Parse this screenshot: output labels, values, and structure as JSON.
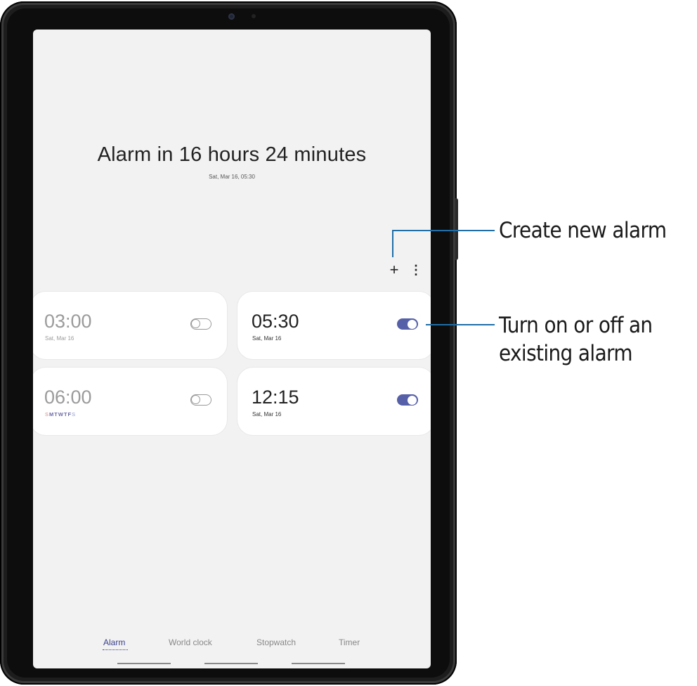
{
  "summary": {
    "headline": "Alarm in 16 hours 24 minutes",
    "next_alarm": "Sat, Mar 16, 05:30"
  },
  "toolbar": {
    "add_icon": "plus-icon",
    "add_glyph": "+",
    "more_icon": "more-vertical-icon",
    "more_glyph": "⋮"
  },
  "alarms": [
    {
      "time": "03:00",
      "sub": "Sat, Mar 16",
      "enabled": false
    },
    {
      "time": "05:30",
      "sub": "Sat, Mar 16",
      "enabled": true
    },
    {
      "time": "06:00",
      "sub": "SMTWTFS",
      "enabled": false
    },
    {
      "time": "12:15",
      "sub": "Sat, Mar 16",
      "enabled": true
    }
  ],
  "tabs": [
    {
      "label": "Alarm",
      "active": true
    },
    {
      "label": "World clock",
      "active": false
    },
    {
      "label": "Stopwatch",
      "active": false
    },
    {
      "label": "Timer",
      "active": false
    }
  ],
  "callouts": {
    "create": "Create new alarm",
    "toggle": "Turn on or off an existing alarm"
  },
  "colors": {
    "accent": "#5560a8",
    "callout_line": "#1f6ea8",
    "screen_bg": "#f2f2f2",
    "card_bg": "#ffffff"
  }
}
